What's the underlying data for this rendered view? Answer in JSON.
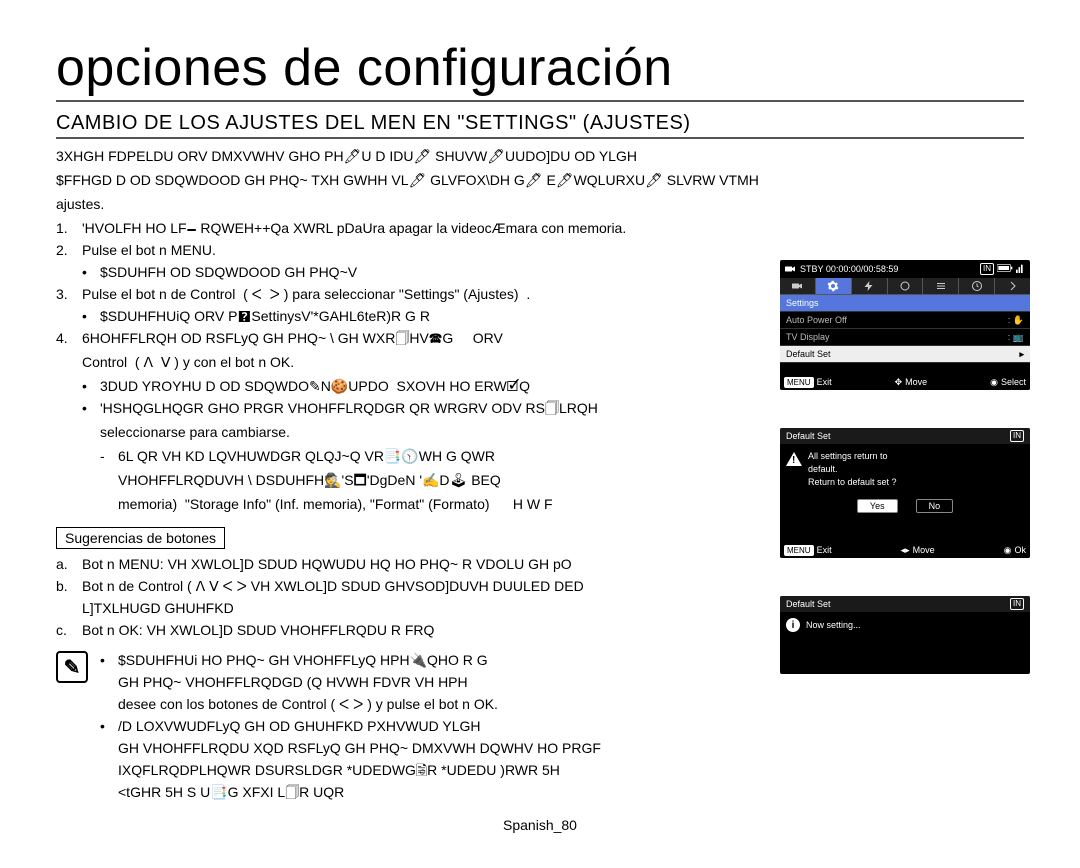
{
  "title": "opciones de configuración",
  "subtitle": "CAMBIO DE LOS AJUSTES DEL MEN EN \"SETTINGS\" (AJUSTES)",
  "intro_l1": "3XHGH FDPELDU ORV DMXVWHV GHO PH🖊U D IDU🖊 SHUVW🖊UUDO]DU OD YLGH",
  "intro_l2": "$FFHGD D OD SDQWDOOD GH PHQ~ TXH GWHH VL🖊 GLVFOX\\DH G🖊 E🖊WQLURXU🖊 SLVRW VTMH",
  "intro_l3": "ajustes.",
  "steps": [
    {
      "n": "1.",
      "t": "'HVOLFH HO LF🗕 RQWEH++Qa XWRL pDaUra apagar la videocÆmara con memoria."
    },
    {
      "n": "2.",
      "t": "Pulse el bot n MENU."
    }
  ],
  "step2_bullet": "$SDUHFH OD SDQWDOOD GH PHQ~V",
  "step3": {
    "n": "3.",
    "t": "Pulse el bot n de Control  ( ᐸ  ᐳ ) para seleccionar \"Settings\" (Ajustes)  ."
  },
  "step3_bullet": "$SDUHFHUiQ ORV P🯄SettinysV'*GAHL6teR)R G R",
  "step4": {
    "n": "4.",
    "t": "6HOHFFLRQH OD RSFLyQ GH PHQ~ \\ GH WXR🗍HV🕿G     ORV"
  },
  "step4_sub": "Control  ( ᐱ  ᐯ ) y con el bot n OK.",
  "step4_b1": "3DUD YROYHU D OD SDQWDO✎N🍪UPDO  SXOVH HO ERW🗹Q",
  "step4_b2": "'HSHQGLHQGR GHO PRGR VHOHFFLRQDGR QR WRGRV ODV RS🗍LRQH",
  "step4_b2_sub": "seleccionarse para cambiarse.",
  "step4_sub_bullet": "6L QR VH KD LQVHUWDGR QLQJ~Q VR📑🕥WH G        QWR",
  "step4_sub_bullet2": "VHOHFFLRQDUVH \\ DSDUHFH🕵'S🗖'DgDeN '✍D🕹 BEQ",
  "step4_sub_bullet3": "memoria)  \"Storage Info\" (Inf. memoria), \"Format\" (Formato)      H W F",
  "sug_title": "Sugerencias de botones",
  "sug_abc": [
    {
      "n": "a.",
      "t": "Bot n MENU:  VH XWLOL]D SDUD HQWUDU HQ HO PHQ~ R VDOLU GH pO"
    },
    {
      "n": "b.",
      "t": "Bot n de Control  ( ᐱ  ᐯ  ᐸ  ᐳ      VH XWLOL]D SDUD GHVSOD]DUVH DUULED DED"
    },
    {
      "n": "",
      "t": "L]TXLHUGD GHUHFKD"
    },
    {
      "n": "c.",
      "t": "Bot n OK:  VH XWLOL]D SDUD VHOHFFLRQDU R FRQ"
    }
  ],
  "notes": [
    "$SDUHFHUi HO PHQ~ GH VHOHFFLyQ HPH🔌QHO           R G",
    "GH PHQ~ VHOHFFLRQDGD  (Q HVWH FDVR  VH             HPH",
    "desee con los botones de Control  ( ᐸ  ᐳ ) y pulse el bot n OK.",
    "/D LOXVWUDFLyQ GH OD GHUHFKD PXHVWUD             YLGH",
    "GH VHOHFFLRQDU XQD RSFLyQ GH PHQ~  DMXVWH DQWHV HO PRGF",
    "IXQFLRQDPLHQWR DSURSLDGR  *UDEDWG🗟R  *UDEDU )RWR  5H",
    "<tGHR    5H S U📑G XFXI L🗍R UQR"
  ],
  "footer": "Spanish_80",
  "screen1": {
    "top": "STBY 00:00:00/00:58:59",
    "heading": "Settings",
    "rows": [
      {
        "label": "Auto Power Off",
        "icon": "hand"
      },
      {
        "label": "TV Display",
        "icon": "tv"
      },
      {
        "label": "Default Set",
        "icon": "",
        "sel": true
      }
    ],
    "foot_exit": "Exit",
    "foot_move": "Move",
    "foot_select": "Select",
    "menu": "MENU"
  },
  "screen2": {
    "title": "Default Set",
    "warn_l1": "All settings return to",
    "warn_l2": "default.",
    "warn_l3": "Return to default set ?",
    "yes": "Yes",
    "no": "No",
    "foot_exit": "Exit",
    "foot_move": "Move",
    "foot_ok": "Ok",
    "menu": "MENU"
  },
  "screen3": {
    "title": "Default Set",
    "info": "Now setting..."
  }
}
